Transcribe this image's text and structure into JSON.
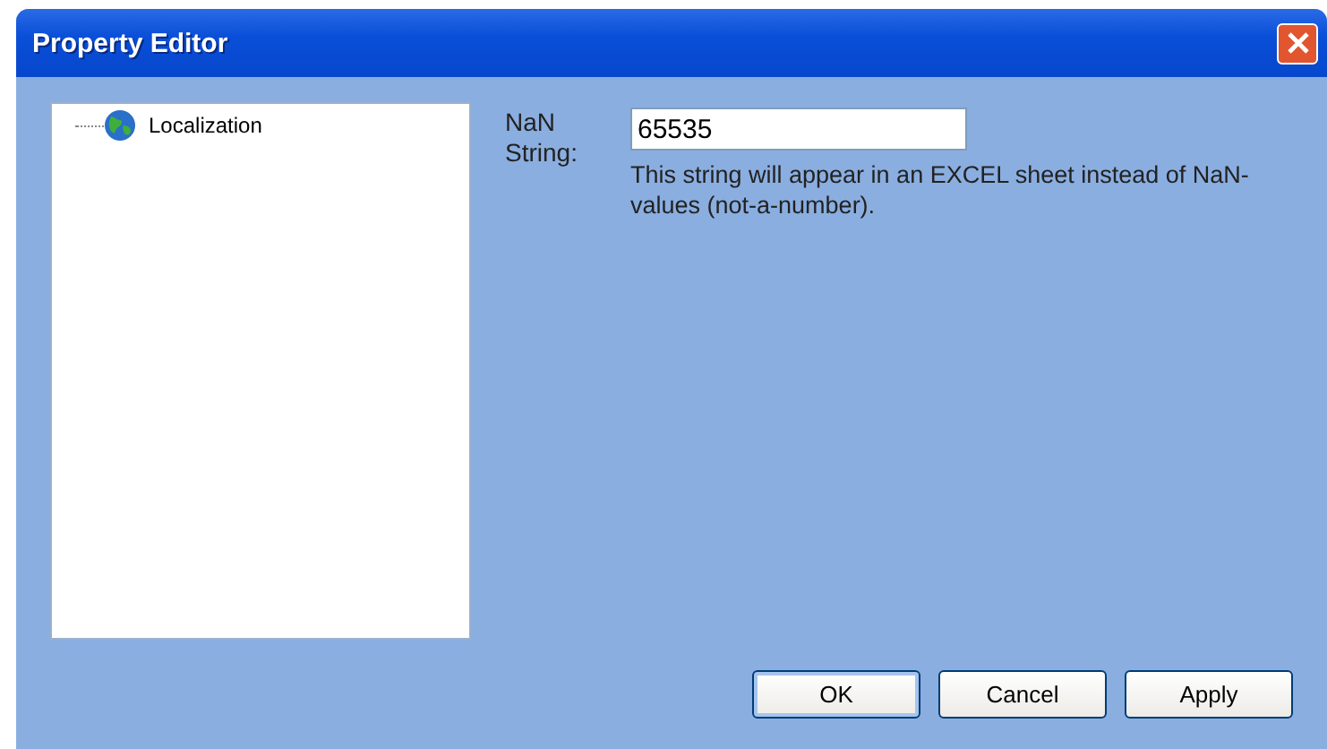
{
  "window": {
    "title": "Property Editor"
  },
  "tree": {
    "items": [
      {
        "label": "Localization",
        "selected": false
      }
    ]
  },
  "property": {
    "label": "NaN String:",
    "value": "65535",
    "description": "This string will appear in an EXCEL sheet instead of NaN-values (not-a-number)."
  },
  "buttons": [
    {
      "label": "OK",
      "default": true
    },
    {
      "label": "Cancel",
      "default": false
    },
    {
      "label": "Apply",
      "default": false
    }
  ]
}
